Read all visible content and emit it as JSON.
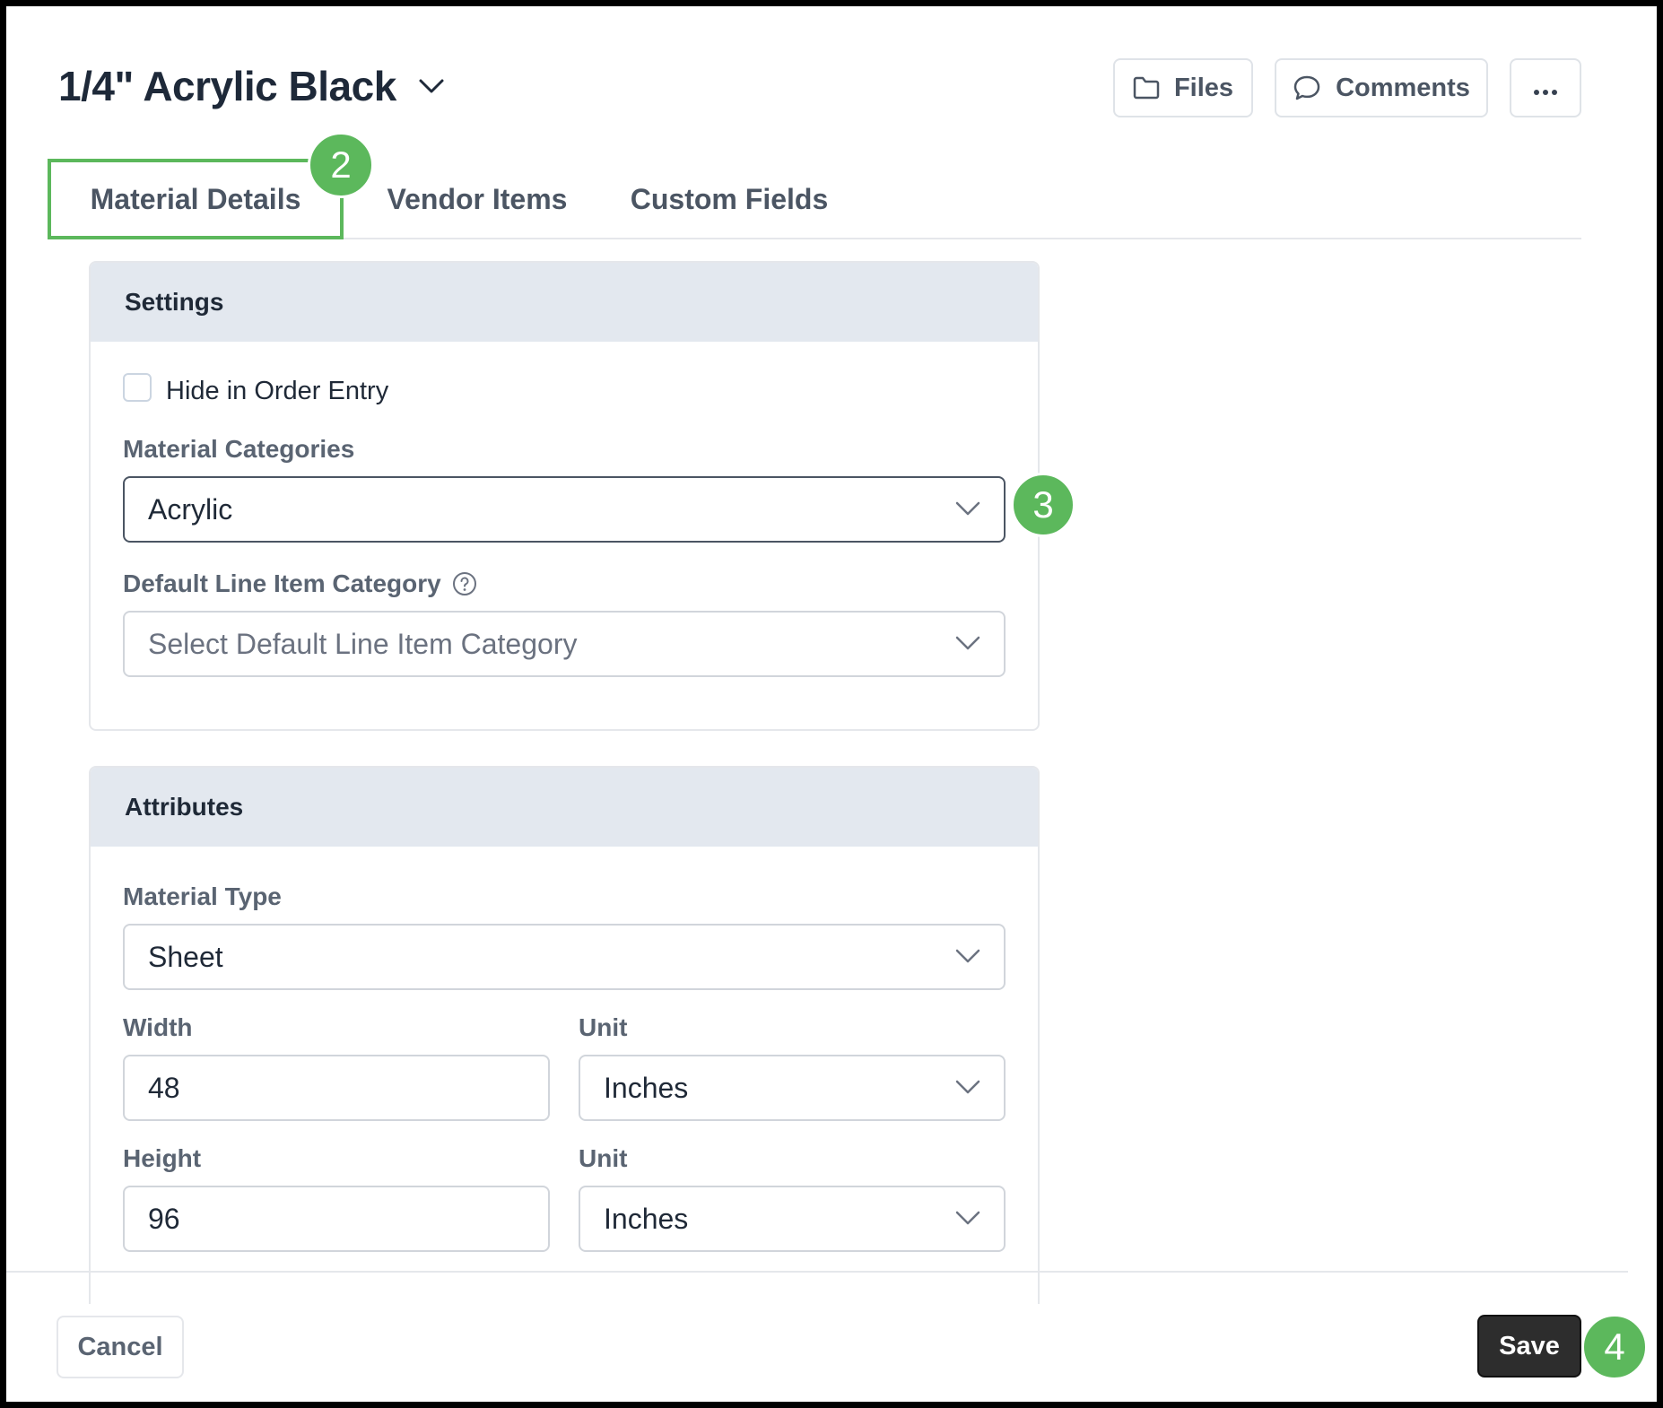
{
  "header": {
    "title": "1/4\" Acrylic Black",
    "files_label": "Files",
    "comments_label": "Comments"
  },
  "tabs": [
    {
      "label": "Material Details",
      "active": true
    },
    {
      "label": "Vendor Items",
      "active": false
    },
    {
      "label": "Custom Fields",
      "active": false
    }
  ],
  "steps": {
    "tab_step": "2",
    "categories_step": "3",
    "save_step": "4"
  },
  "settings": {
    "title": "Settings",
    "hide_in_order_entry_label": "Hide in Order Entry",
    "hide_in_order_entry_checked": false,
    "material_categories_label": "Material Categories",
    "material_categories_value": "Acrylic",
    "default_line_item_category_label": "Default Line Item Category",
    "default_line_item_category_placeholder": "Select Default Line Item Category"
  },
  "attributes": {
    "title": "Attributes",
    "material_type_label": "Material Type",
    "material_type_value": "Sheet",
    "width_label": "Width",
    "width_value": "48",
    "width_unit_label": "Unit",
    "width_unit_value": "Inches",
    "height_label": "Height",
    "height_value": "96",
    "height_unit_label": "Unit",
    "height_unit_value": "Inches"
  },
  "footer": {
    "cancel_label": "Cancel",
    "save_label": "Save"
  },
  "colors": {
    "step_badge": "#5cb85c",
    "active_tab_outline": "#5cb85c",
    "card_header_bg": "#e3e8ef",
    "save_button_bg": "#2d2d2d"
  },
  "icons": {
    "title_dropdown": "chevron-down-icon",
    "files": "folder-icon",
    "comments": "speech-bubble-icon",
    "more": "more-horizontal-icon",
    "help": "question-circle-icon",
    "select_caret": "chevron-down-icon"
  }
}
